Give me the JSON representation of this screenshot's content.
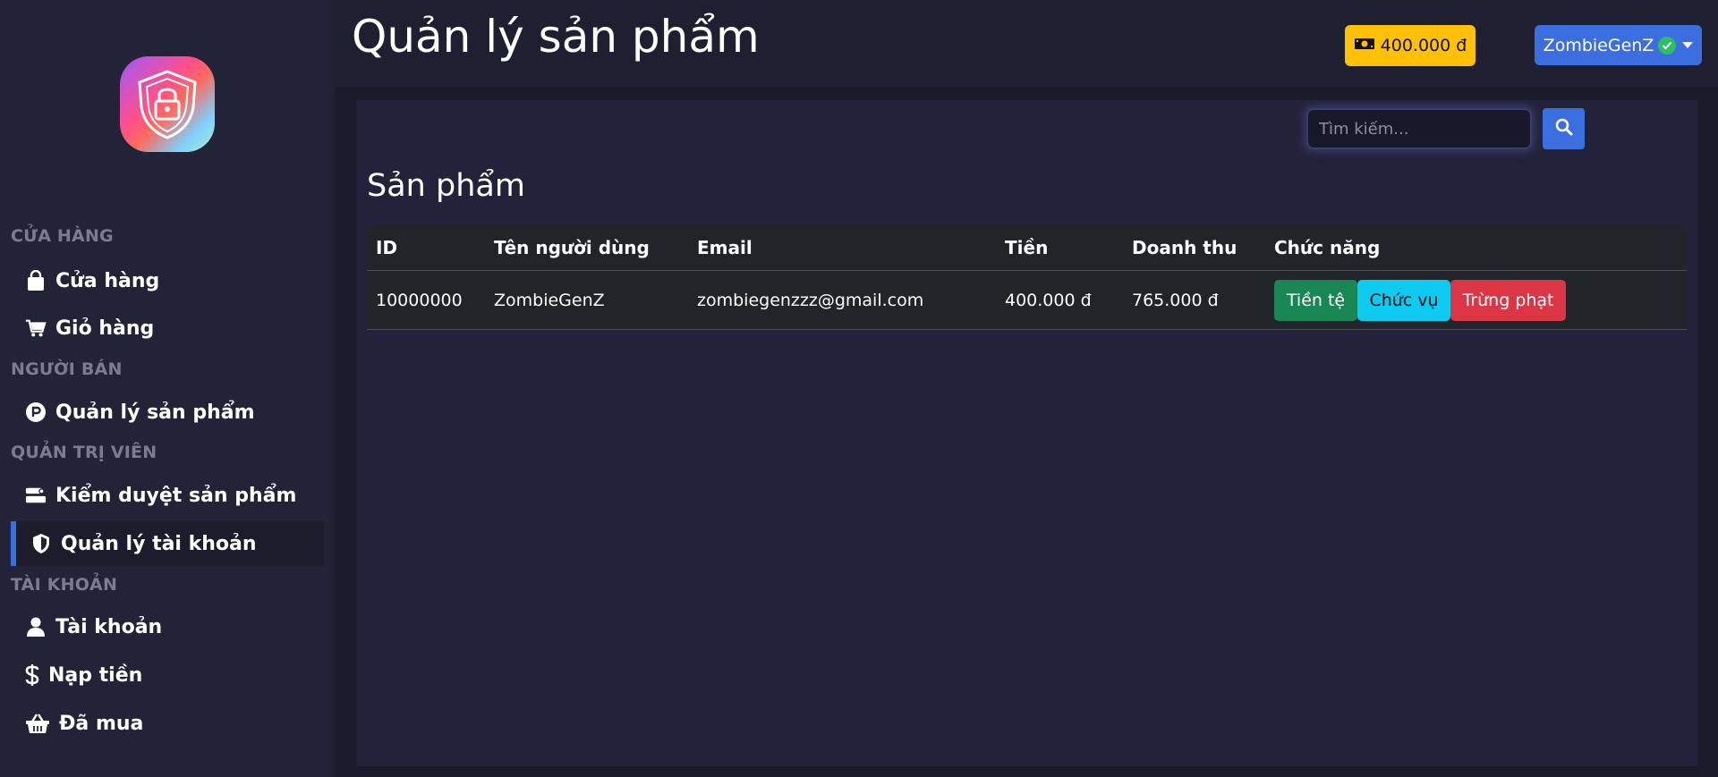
{
  "header": {
    "title": "Quản lý sản phẩm",
    "balance": "400.000 đ",
    "username": "ZombieGenZ"
  },
  "sidebar": {
    "sections": [
      {
        "title": "CỬA HÀNG",
        "items": [
          {
            "label": "Cửa hàng",
            "icon": "shopping-bag-icon"
          },
          {
            "label": "Giỏ hàng",
            "icon": "cart-icon"
          }
        ]
      },
      {
        "title": "NGƯỜI BÁN",
        "items": [
          {
            "label": "Quản lý sản phẩm",
            "icon": "product-circle-icon"
          }
        ]
      },
      {
        "title": "QUẢN TRỊ VIÊN",
        "items": [
          {
            "label": "Kiểm duyệt sản phẩm",
            "icon": "moderation-icon"
          },
          {
            "label": "Quản lý tài khoản",
            "icon": "shield-icon",
            "active": true
          }
        ]
      },
      {
        "title": "TÀI KHOẢN",
        "items": [
          {
            "label": "Tài khoản",
            "icon": "user-icon"
          },
          {
            "label": "Nạp tiền",
            "icon": "dollar-icon"
          },
          {
            "label": "Đã mua",
            "icon": "basket-icon"
          }
        ]
      }
    ]
  },
  "search": {
    "placeholder": "Tìm kiếm..."
  },
  "main": {
    "heading": "Sản phẩm",
    "columns": [
      "ID",
      "Tên người dùng",
      "Email",
      "Tiền",
      "Doanh thu",
      "Chức năng"
    ],
    "rows": [
      {
        "id": "10000000",
        "username": "ZombieGenZ",
        "email": "zombiegenzzz@gmail.com",
        "money": "400.000 đ",
        "revenue": "765.000 đ",
        "actions": [
          "Tiền tệ",
          "Chức vụ",
          "Trừng phạt"
        ]
      }
    ]
  },
  "colors": {
    "accent": "#3b6fe0",
    "warning": "#ffc107",
    "success": "#198754",
    "info": "#0dcaf0",
    "danger": "#dc3545"
  }
}
